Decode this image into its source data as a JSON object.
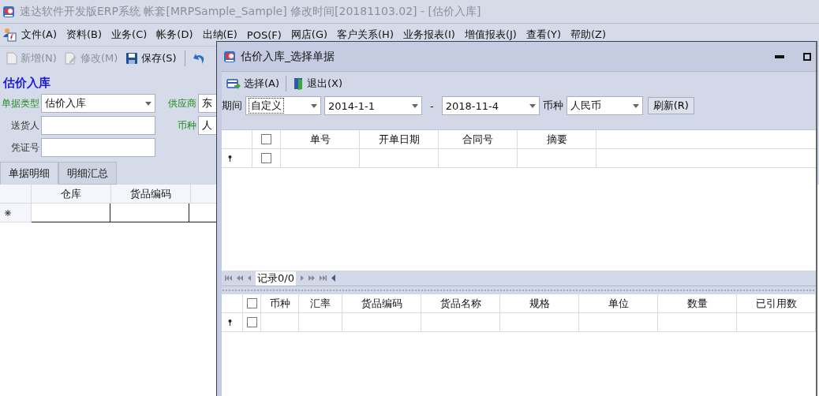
{
  "window": {
    "title": "速达软件开发版ERP系统  帐套[MRPSample_Sample] 修改时间[20181103.02] - [估价入库]"
  },
  "menu": [
    "文件(A)",
    "资料(B)",
    "业务(C)",
    "帐务(D)",
    "出纳(E)",
    "POS(F)",
    "网店(G)",
    "客户关系(H)",
    "业务报表(I)",
    "增值报表(J)",
    "查看(Y)",
    "帮助(Z)"
  ],
  "toolbar": [
    {
      "kind": "button",
      "label": "新增(N)",
      "disabled": true
    },
    {
      "kind": "button",
      "label": "修改(M)",
      "disabled": true
    },
    {
      "kind": "button",
      "label": "保存(S)",
      "disabled": false
    },
    {
      "kind": "separator"
    },
    {
      "kind": "icon"
    }
  ],
  "form": {
    "heading": "估价入库",
    "fields_left": [
      {
        "label": "单据类型",
        "required": true,
        "kind": "select",
        "value": "估价入库"
      },
      {
        "label": "送货人",
        "required": false,
        "kind": "text"
      },
      {
        "label": "凭证号",
        "required": false,
        "kind": "text"
      }
    ],
    "fields_right": [
      {
        "label": "供应商",
        "required": true,
        "value": "东"
      },
      {
        "label": "币种",
        "required": true,
        "value": "人"
      }
    ]
  },
  "tabs": [
    {
      "label": "单据明细",
      "selected": true
    },
    {
      "label": "明细汇总",
      "selected": false
    }
  ],
  "detail_grid": {
    "columns": [
      "仓库",
      "货品编码"
    ]
  },
  "dialog": {
    "title": "估价入库_选择单据",
    "toolbar": [
      {
        "label": "选择(A)"
      },
      {
        "label": "退出(X)"
      }
    ],
    "filter": {
      "period_label": "期间",
      "period": "自定义",
      "start": "2014-1-1",
      "separator": "-",
      "end": "2018-11-4",
      "currency_label": "币种",
      "currency": "人民币",
      "refresh": "刷新(R)"
    },
    "upper_grid": {
      "columns": [
        "单号",
        "开单日期",
        "合同号",
        "摘要"
      ],
      "header_checked": false,
      "row_checked": false
    },
    "navigator": {
      "record": "记录0/0"
    },
    "lower_grid": {
      "columns": [
        "币种",
        "汇率",
        "货品编码",
        "货品名称",
        "规格",
        "单位",
        "数量",
        "已引用数"
      ],
      "header_checked": false,
      "row_checked": false
    }
  }
}
